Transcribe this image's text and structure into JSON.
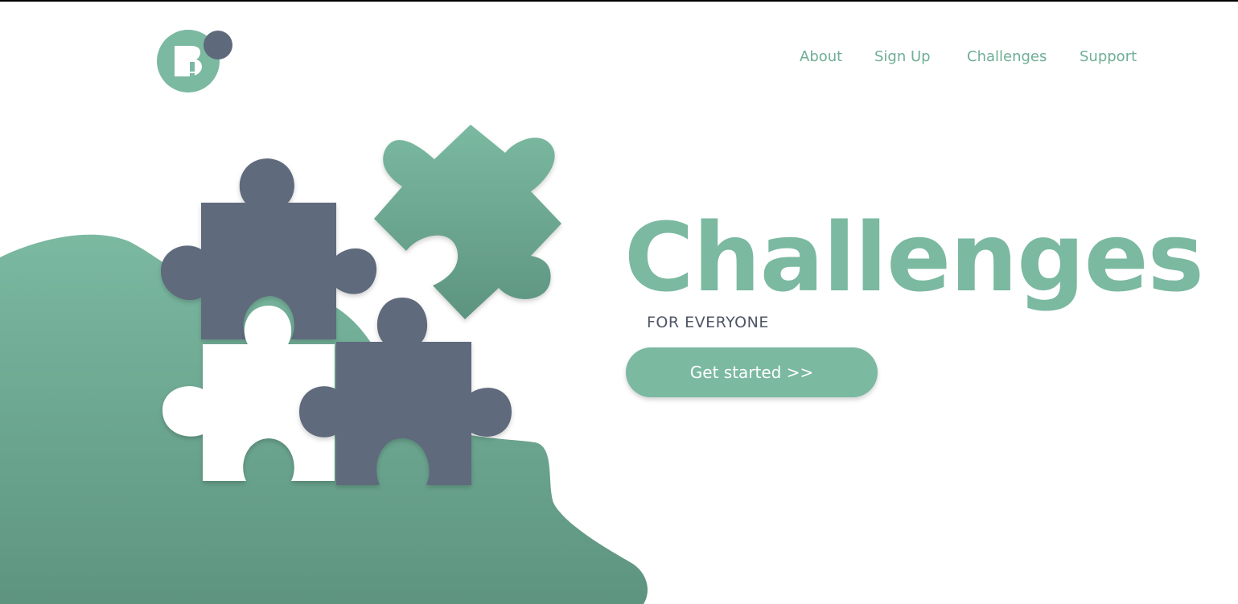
{
  "logo": {
    "name": "logo-icon",
    "colors": {
      "primary": "#7bb9a1",
      "secondary": "#5e6a7b"
    }
  },
  "nav": {
    "items": [
      {
        "label": "About"
      },
      {
        "label": "Sign Up"
      },
      {
        "label": "Challenges"
      },
      {
        "label": "Support"
      }
    ]
  },
  "hero": {
    "title": "Challenges",
    "subtitle": "FOR EVERYONE",
    "cta_label": "Get started >>"
  },
  "illustration": {
    "name": "puzzle-pieces-illustration",
    "pieces": [
      {
        "name": "slate-piece-top-left",
        "color": "#5e6a7b"
      },
      {
        "name": "green-piece-rotated",
        "color": "#7bb9a1"
      },
      {
        "name": "white-piece-bottom-left",
        "color": "#ffffff"
      },
      {
        "name": "slate-piece-bottom-right",
        "color": "#5e6a7b"
      }
    ]
  },
  "colors": {
    "accent": "#7bb9a1",
    "accent_dark": "#5d9480",
    "slate": "#5e6a7b",
    "text_dark": "#4e5666",
    "background": "#ffffff"
  }
}
